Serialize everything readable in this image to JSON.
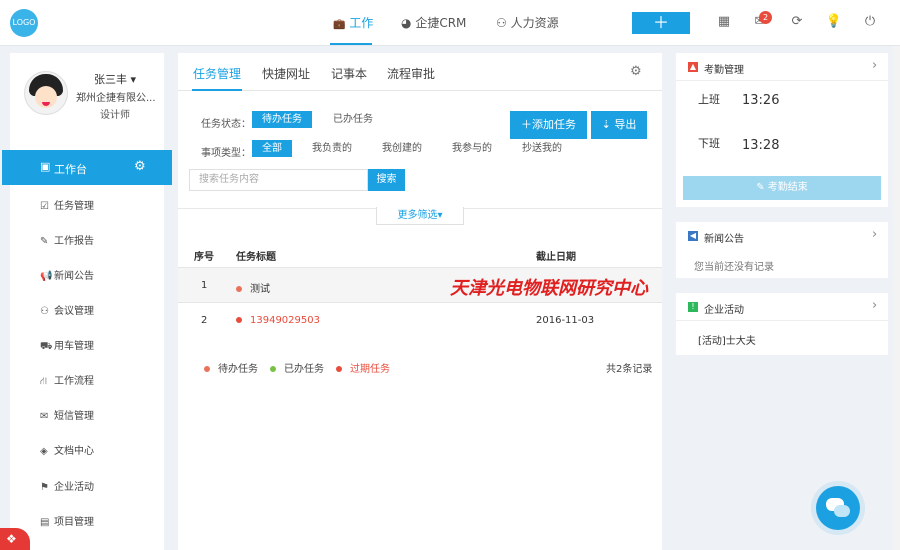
{
  "topbar": {
    "logo": "LOGO",
    "nav": [
      {
        "icon": "briefcase-icon",
        "glyph": "💼",
        "label": "工作",
        "active": true
      },
      {
        "icon": "pie-chart-icon",
        "glyph": "◕",
        "label": "企捷CRM",
        "active": false
      },
      {
        "icon": "users-icon",
        "glyph": "⚇",
        "label": "人力资源",
        "active": false
      }
    ],
    "add_label": "＋",
    "notification_count": "2"
  },
  "profile": {
    "name": "张三丰 ▾",
    "company": "郑州企捷有限公...",
    "title": "设计师"
  },
  "sidebar": {
    "active": {
      "label": "工作台",
      "icon_glyph": "▣"
    },
    "items": [
      {
        "label": "任务管理",
        "glyph": "☑",
        "icon": "task-icon"
      },
      {
        "label": "工作报告",
        "glyph": "✎",
        "icon": "report-icon"
      },
      {
        "label": "新闻公告",
        "glyph": "📢",
        "icon": "megaphone-icon"
      },
      {
        "label": "会议管理",
        "glyph": "⚇",
        "icon": "meeting-icon"
      },
      {
        "label": "用车管理",
        "glyph": "⛟",
        "icon": "car-icon"
      },
      {
        "label": "工作流程",
        "glyph": "⛙",
        "icon": "workflow-icon"
      },
      {
        "label": "短信管理",
        "glyph": "✉",
        "icon": "sms-icon"
      },
      {
        "label": "文档中心",
        "glyph": "◈",
        "icon": "document-icon"
      },
      {
        "label": "企业活动",
        "glyph": "⚑",
        "icon": "flag-icon"
      },
      {
        "label": "项目管理",
        "glyph": "▤",
        "icon": "project-icon"
      }
    ]
  },
  "main": {
    "tabs": [
      "任务管理",
      "快捷网址",
      "记事本",
      "流程审批"
    ],
    "filters": {
      "status_label": "任务状态：",
      "status_options": [
        "待办任务",
        "已办任务"
      ],
      "type_label": "事项类型：",
      "type_options": [
        "全部",
        "我负责的",
        "我创建的",
        "我参与的",
        "抄送我的"
      ]
    },
    "add_task_label": "＋添加任务",
    "export_label": "⇣ 导出",
    "search_placeholder": "搜索任务内容",
    "search_button": "搜索",
    "more_filter": "更多筛选▾",
    "table": {
      "headers": [
        "序号",
        "任务标题",
        "截止日期"
      ],
      "rows": [
        {
          "index": "1",
          "title": "测试",
          "date": ""
        },
        {
          "index": "2",
          "title": "13949029503",
          "date": "2016-11-03"
        }
      ]
    },
    "legend": [
      "待办任务",
      "已办任务",
      "过期任务"
    ],
    "record_count": "共2条记录",
    "watermark": "天津光电物联网研究中心"
  },
  "attendance": {
    "title": "考勤管理",
    "on_label": "上班",
    "on_time": "13:26",
    "off_label": "下班",
    "off_time": "13:28",
    "button": "考勤结束"
  },
  "news": {
    "title": "新闻公告",
    "empty": "您当前还没有记录"
  },
  "activity": {
    "title": "企业活动",
    "item": "[活动]士大夫"
  },
  "colors": {
    "accent": "#1ba1e2",
    "pending": "#e8735a",
    "done": "#7ac143",
    "overdue": "#e84c3d"
  }
}
